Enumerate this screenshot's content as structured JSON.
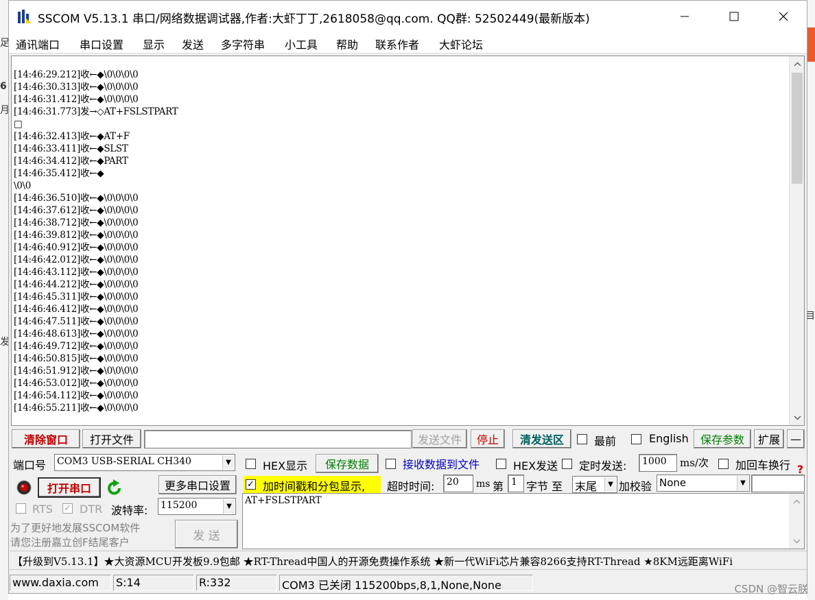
{
  "window": {
    "title": "SSCOM V5.13.1 串口/网络数据调试器,作者:大虾丁丁,2618058@qq.com. QQ群: 52502449(最新版本)"
  },
  "menu": [
    "通讯端口",
    "串口设置",
    "显示",
    "发送",
    "多字符串",
    "小工具",
    "帮助",
    "联系作者",
    "大虾论坛"
  ],
  "receive_log": [
    "[14:46:29.212]收←◆\\0\\0\\0\\0",
    "[14:46:30.313]收←◆\\0\\0\\0\\0",
    "[14:46:31.412]收←◆\\0\\0\\0\\0",
    "[14:46:31.773]发→◇AT+FSLSTPART",
    "□",
    "[14:46:32.413]收←◆AT+F",
    "[14:46:33.411]收←◆SLST",
    "[14:46:34.412]收←◆PART",
    "[14:46:35.412]收←◆",
    "\\0\\0",
    "[14:46:36.510]收←◆\\0\\0\\0\\0",
    "[14:46:37.612]收←◆\\0\\0\\0\\0",
    "[14:46:38.712]收←◆\\0\\0\\0\\0",
    "[14:46:39.812]收←◆\\0\\0\\0\\0",
    "[14:46:40.912]收←◆\\0\\0\\0\\0",
    "[14:46:42.012]收←◆\\0\\0\\0\\0",
    "[14:46:43.112]收←◆\\0\\0\\0\\0",
    "[14:46:44.212]收←◆\\0\\0\\0\\0",
    "[14:46:45.311]收←◆\\0\\0\\0\\0",
    "[14:46:46.412]收←◆\\0\\0\\0\\0",
    "[14:46:47.511]收←◆\\0\\0\\0\\0",
    "[14:46:48.613]收←◆\\0\\0\\0\\0",
    "[14:46:49.712]收←◆\\0\\0\\0\\0",
    "[14:46:50.815]收←◆\\0\\0\\0\\0",
    "[14:46:51.912]收←◆\\0\\0\\0\\0",
    "[14:46:53.012]收←◆\\0\\0\\0\\0",
    "[14:46:54.112]收←◆\\0\\0\\0\\0",
    "[14:46:55.211]收←◆\\0\\0\\0\\0"
  ],
  "toolbar": {
    "clear": "清除窗口",
    "open_file": "打开文件",
    "file_path": "",
    "send_file": "发送文件",
    "stop": "停止",
    "clear_send": "清发送区",
    "topmost": "最前",
    "english": "English",
    "save_params": "保存参数",
    "expand": "扩展",
    "collapse": "—"
  },
  "port": {
    "port_label": "端口号",
    "port_value": "COM3 USB-SERIAL CH340",
    "open_port": "打开串口",
    "more_settings": "更多串口设置",
    "rts": "RTS",
    "dtr": "DTR",
    "baud_label": "波特率:",
    "baud_value": "115200",
    "promo_line1": "为了更好地发展SSCOM软件",
    "promo_line2": "请您注册嘉立创F结尾客户",
    "send": "发  送"
  },
  "options": {
    "hex_display": "HEX显示",
    "save_data": "保存数据",
    "recv_to_file": "接收数据到文件",
    "hex_send": "HEX发送",
    "timed_send": "定时发送:",
    "timed_value": "1000",
    "timed_unit": "ms/次",
    "add_crlf": "加回车换行",
    "timestamp": "加时间戳和分包显示,",
    "timeout_label": "超时时间:",
    "timeout_value": "20",
    "timeout_unit": "ms",
    "byte_label_pre": "第",
    "byte_value": "1",
    "byte_label_post": "字节 至",
    "end_value": "末尾",
    "checksum_label": "加校验",
    "checksum_value": "None"
  },
  "send_text": "AT+FSLSTPART",
  "promo_bar": "【升级到V5.13.1】★大资源MCU开发板9.9包邮 ★RT-Thread中国人的开源免费操作系统 ★新一代WiFi芯片兼容8266支持RT-Thread ★8KM远距离WiFi",
  "status": {
    "website": "www.daxia.com",
    "sent": "S:14",
    "received": "R:332",
    "port_status": "COM3 已关闭  115200bps,8,1,None,None"
  },
  "watermark": "CSDN @智云朕",
  "colors": {
    "clear_button_text": "#c00000",
    "green_text": "#008000",
    "blue_text": "#0000c0",
    "timestamp_highlight": "#ffff00",
    "stop_text": "#c00000",
    "clear_send_text": "#006060"
  }
}
